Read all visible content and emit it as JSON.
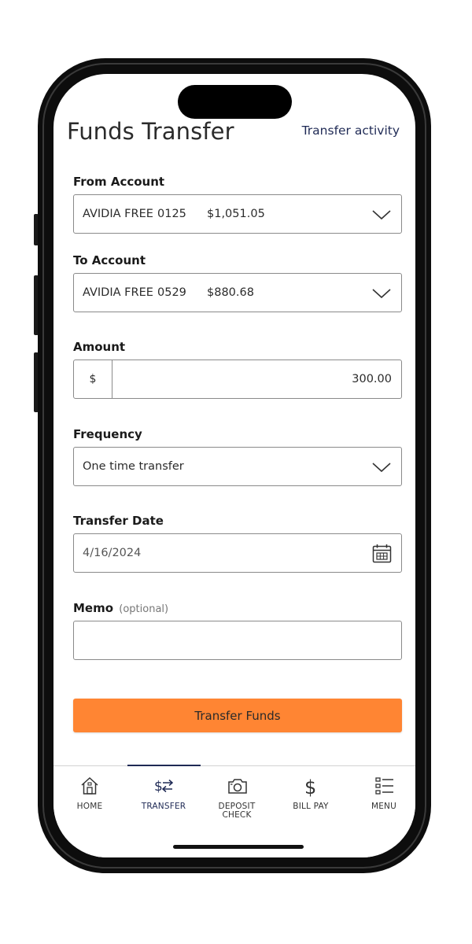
{
  "header": {
    "title": "Funds Transfer",
    "activity_link": "Transfer activity"
  },
  "form": {
    "from_account": {
      "label": "From Account",
      "name": "AVIDIA FREE",
      "number": "0125",
      "balance": "$1,051.05"
    },
    "to_account": {
      "label": "To Account",
      "name": "AVIDIA FREE",
      "number": "0529",
      "balance": "$880.68"
    },
    "amount": {
      "label": "Amount",
      "currency_symbol": "$",
      "value": "300.00"
    },
    "frequency": {
      "label": "Frequency",
      "value": "One time transfer"
    },
    "transfer_date": {
      "label": "Transfer Date",
      "value": "4/16/2024"
    },
    "memo": {
      "label": "Memo",
      "optional_hint": "(optional)",
      "value": ""
    },
    "submit_label": "Transfer Funds"
  },
  "tabbar": {
    "active": "transfer",
    "items": [
      {
        "id": "home",
        "label": "HOME",
        "icon": "home-icon"
      },
      {
        "id": "transfer",
        "label": "TRANSFER",
        "icon": "transfer-arrows-icon"
      },
      {
        "id": "deposit",
        "label_line1": "DEPOSIT",
        "label_line2": "CHECK",
        "icon": "camera-icon"
      },
      {
        "id": "billpay",
        "label": "BILL PAY",
        "icon": "dollar-icon"
      },
      {
        "id": "menu",
        "label": "MENU",
        "icon": "menu-list-icon"
      }
    ]
  },
  "colors": {
    "accent": "#ff8533",
    "brand_navy": "#1f2a55"
  }
}
